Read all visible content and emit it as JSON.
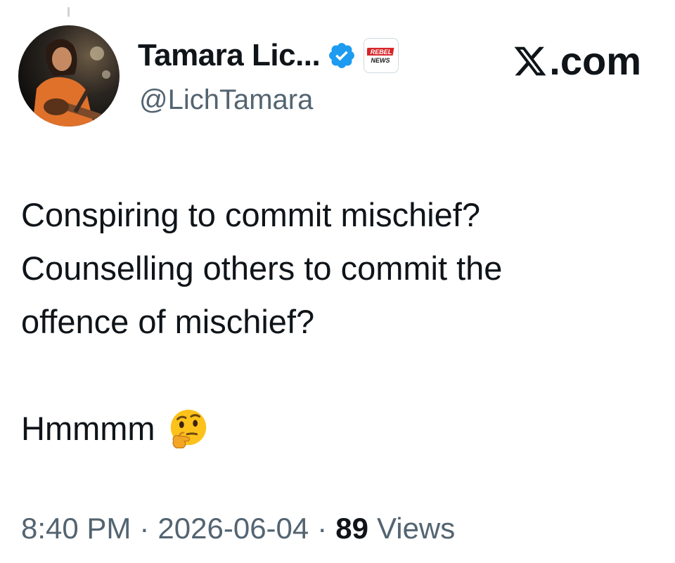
{
  "author": {
    "display_name": "Tamara Lic...",
    "handle": "@LichTamara",
    "verified": true,
    "affiliation_badge_text": [
      "REBEL",
      "NEWS"
    ]
  },
  "watermark": {
    "logo": "x-logo-icon",
    "text": ".com"
  },
  "tweet": {
    "lines": [
      "Conspiring to commit mischief?",
      "Counselling others to commit the",
      "offence of mischief?"
    ],
    "closing_text": "Hmmmm",
    "closing_emoji": "thinking-face-icon"
  },
  "meta": {
    "time": "8:40 PM",
    "separator": "·",
    "date": "2026-06-04",
    "views_count": "89",
    "views_label": "Views"
  },
  "colors": {
    "text_primary": "#0f1419",
    "text_secondary": "#536471",
    "verified_blue": "#1d9bf0",
    "badge_red": "#d7262b"
  }
}
